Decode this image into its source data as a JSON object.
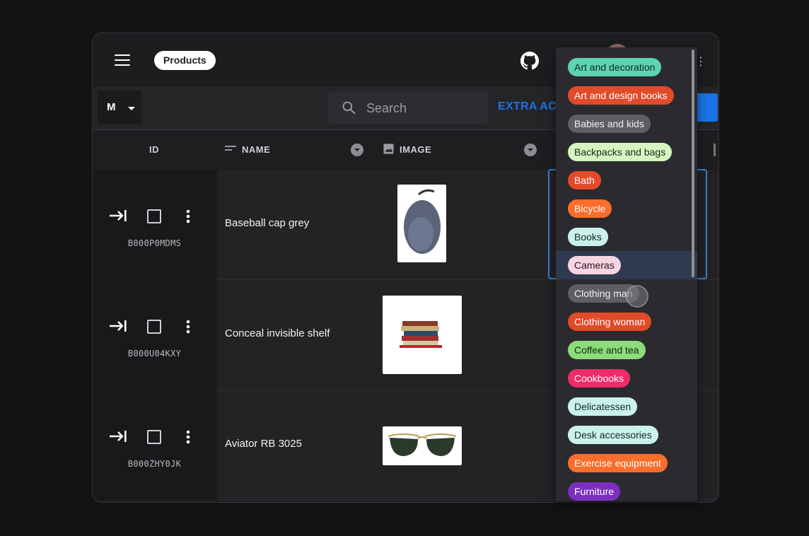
{
  "topbar": {
    "title": "Products"
  },
  "toolbar": {
    "select_value": "M",
    "search_placeholder": "Search",
    "extra_actions": "EXTRA ACT"
  },
  "columns": {
    "id": "ID",
    "name": "NAME",
    "image": "IMAGE"
  },
  "rows": [
    {
      "id": "B000P0MDMS",
      "name": "Baseball cap grey"
    },
    {
      "id": "B000U04KXY",
      "name": "Conceal invisible shelf"
    },
    {
      "id": "B000ZHY0JK",
      "name": "Aviator RB 3025"
    }
  ],
  "dropdown": {
    "options": [
      {
        "label": "Art and decoration",
        "bg": "#5dd3b0",
        "fg": "#0f2b22"
      },
      {
        "label": "Art and design books",
        "bg": "#e24a2a",
        "fg": "#ffffff"
      },
      {
        "label": "Babies and kids",
        "bg": "#5e5e63",
        "fg": "#f0f0f0"
      },
      {
        "label": "Backpacks and bags",
        "bg": "#d6f5c2",
        "fg": "#1c2a14"
      },
      {
        "label": "Bath",
        "bg": "#e24a2a",
        "fg": "#ffffff"
      },
      {
        "label": "Bicycle",
        "bg": "#fb6d2a",
        "fg": "#ffffff"
      },
      {
        "label": "Books",
        "bg": "#c9f3ea",
        "fg": "#142a24"
      },
      {
        "label": "Cameras",
        "bg": "#f7d4e2",
        "fg": "#2b1520"
      },
      {
        "label": "Clothing man",
        "bg": "#5e5e63",
        "fg": "#f0f0f0"
      },
      {
        "label": "Clothing woman",
        "bg": "#e24a2a",
        "fg": "#ffffff"
      },
      {
        "label": "Coffee and tea",
        "bg": "#8bdc7a",
        "fg": "#14280f"
      },
      {
        "label": "Cookbooks",
        "bg": "#ef2b6a",
        "fg": "#ffffff"
      },
      {
        "label": "Delicatessen",
        "bg": "#c9f3ea",
        "fg": "#142a24"
      },
      {
        "label": "Desk accessories",
        "bg": "#c9f3ea",
        "fg": "#142a24"
      },
      {
        "label": "Exercise equipment",
        "bg": "#fb6d2a",
        "fg": "#ffffff"
      },
      {
        "label": "Furniture",
        "bg": "#7b2fbf",
        "fg": "#ffffff"
      }
    ],
    "highlighted_label": "Cameras"
  },
  "colors": {
    "accent": "#1a73e8"
  }
}
